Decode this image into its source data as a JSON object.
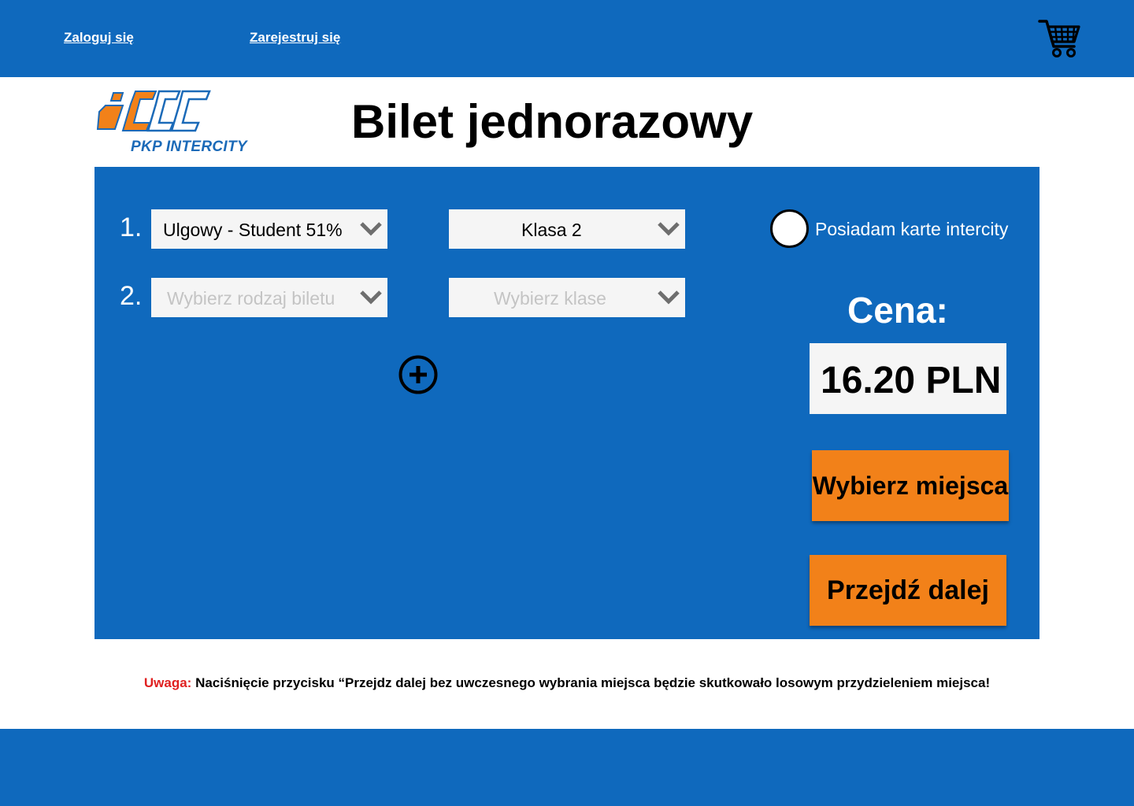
{
  "header": {
    "login_label": "Zaloguj się",
    "register_label": "Zarejestruj się",
    "cart_icon": "shopping-cart-icon"
  },
  "logo": {
    "text": "PKP INTERCITY",
    "brand_colors": [
      "#f28119",
      "#1b6ab8"
    ]
  },
  "page_title": "Bilet jednorazowy",
  "tickets": [
    {
      "number": "1.",
      "type": "Ulgowy - Student 51%",
      "class": "Klasa 2"
    },
    {
      "number": "2.",
      "type_placeholder": "Wybierz rodzaj biletu",
      "class_placeholder": "Wybierz klase"
    }
  ],
  "card_option": {
    "label": "Posiadam karte intercity",
    "checked": false
  },
  "price": {
    "label": "Cena:",
    "value": "16.20 PLN"
  },
  "buttons": {
    "choose_seats": "Wybierz miejsca",
    "proceed": "Przejdź dalej"
  },
  "notice": {
    "warning_label": "Uwaga:",
    "text": "Naciśnięcie przycisku “Przejdz dalej bez uwczesnego wybrania miejsca będzie skutkowało losowym przydzieleniem miejsca!"
  },
  "colors": {
    "primary_blue": "#0f69bd",
    "accent_orange": "#f28119",
    "warning_red": "#e02020"
  }
}
